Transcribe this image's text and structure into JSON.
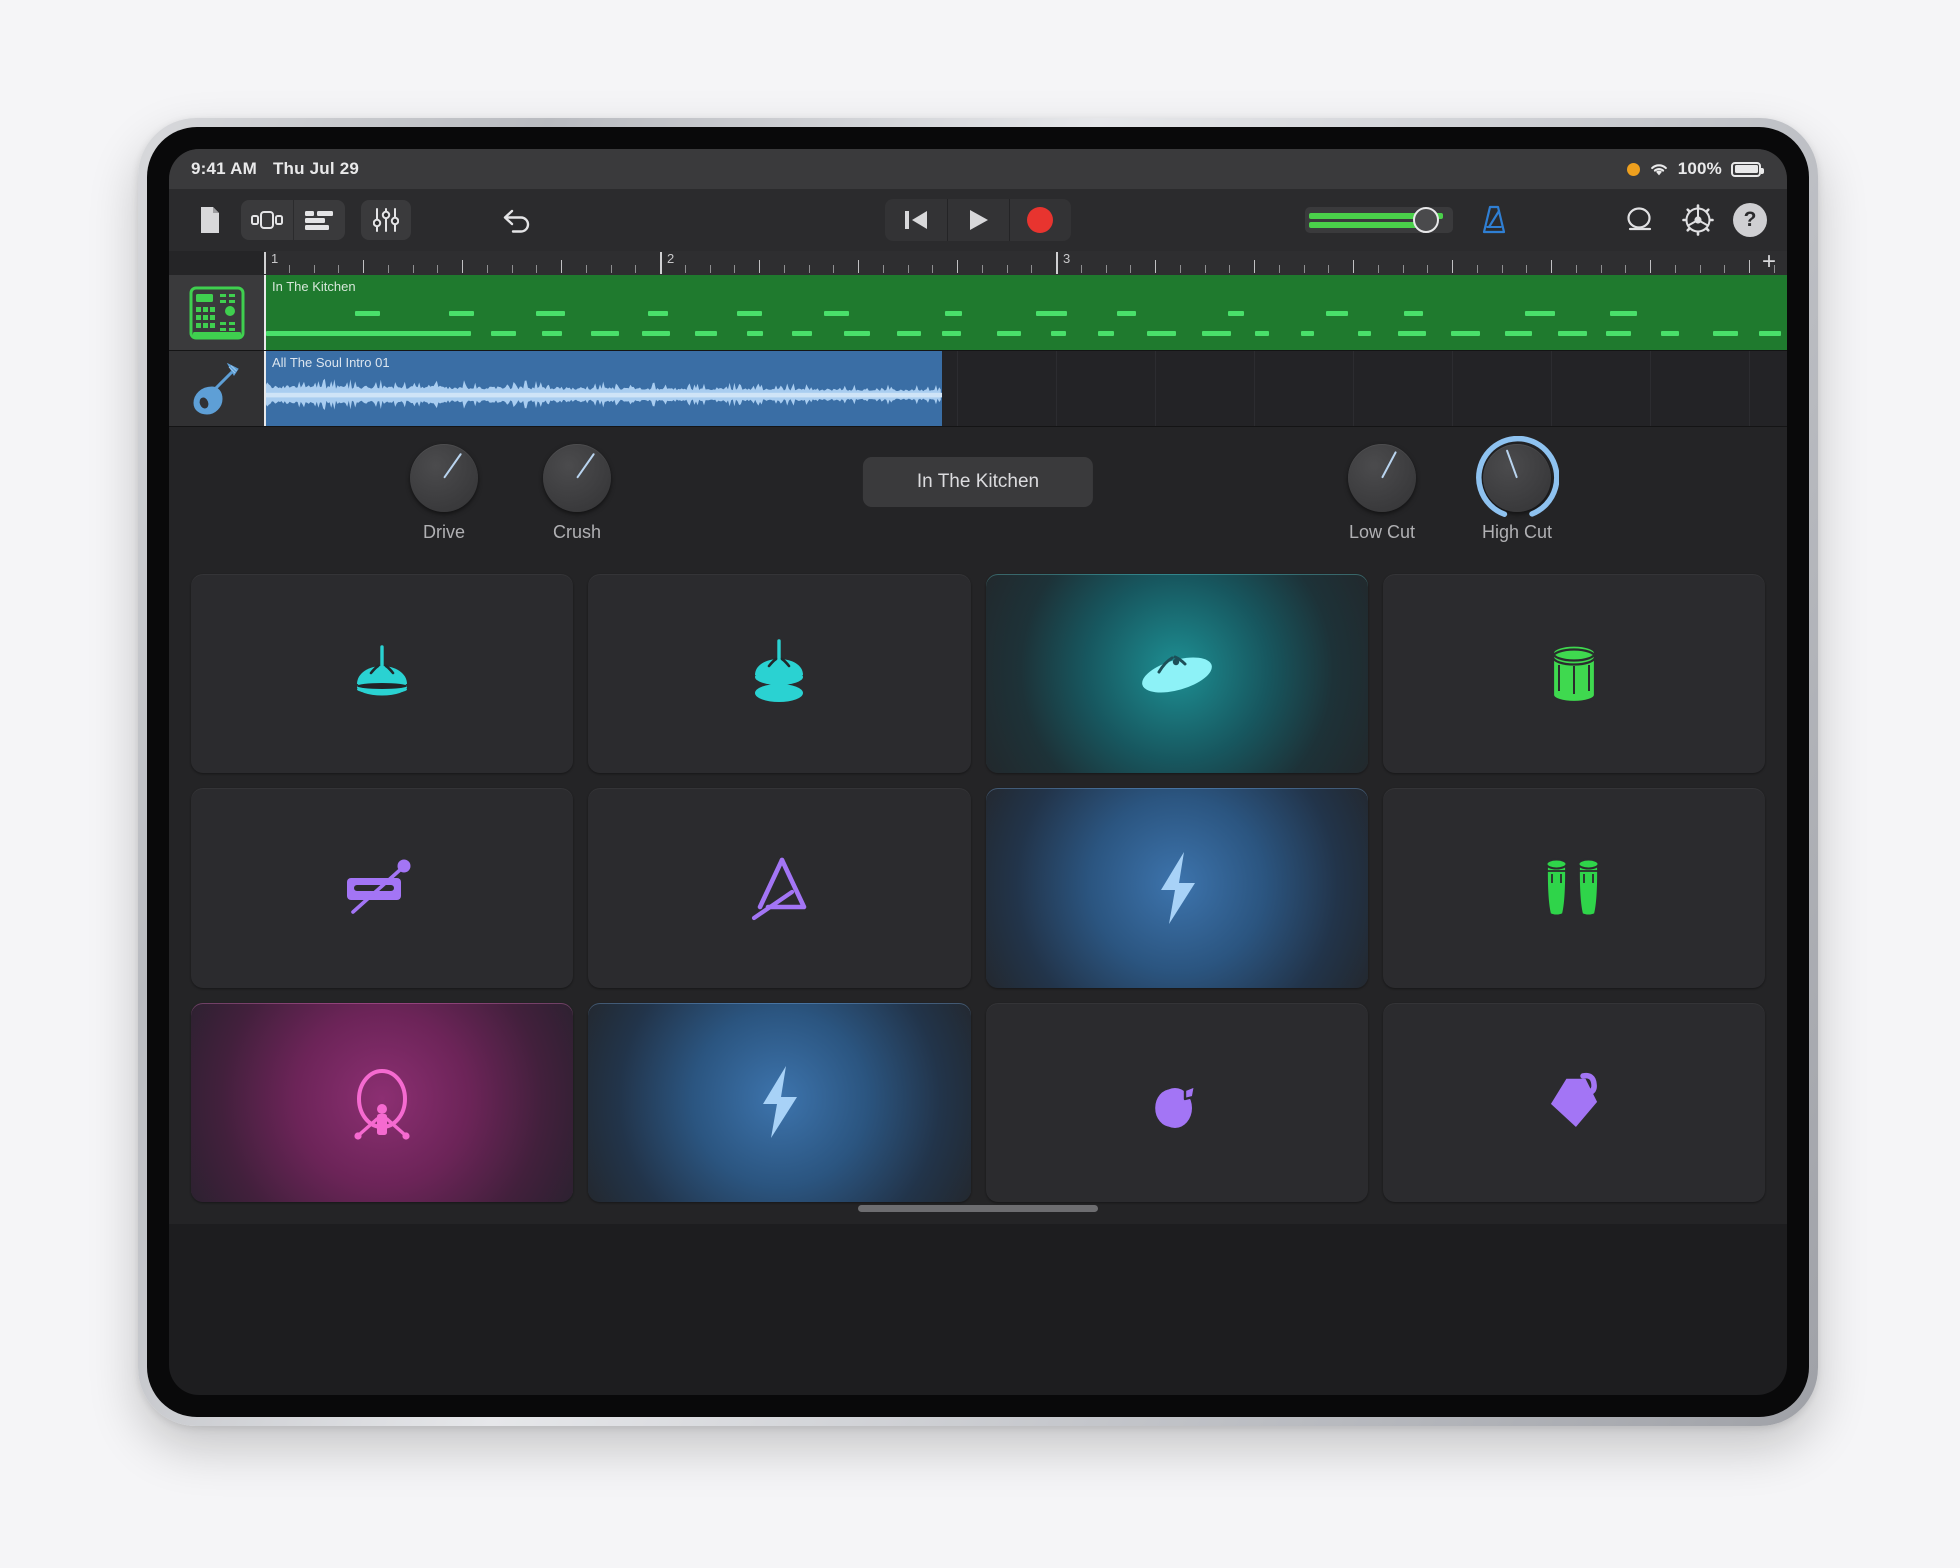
{
  "device": {
    "name": "iPad Pro",
    "home_indicator": true
  },
  "status_bar": {
    "time": "9:41 AM",
    "date": "Thu Jul 29",
    "recording_indicator": "orange-dot",
    "wifi": "wifi-icon",
    "battery_percent": "100%",
    "battery_level": 100
  },
  "toolbar": {
    "left_buttons": [
      {
        "name": "my-songs-button",
        "icon": "document-icon",
        "label": "My Songs"
      },
      {
        "name": "instrument-browser-button",
        "icon": "instrument-view-icon",
        "label": "Instrument View"
      },
      {
        "name": "tracks-view-button",
        "icon": "tracks-view-icon",
        "label": "Tracks View"
      },
      {
        "name": "mixer-button",
        "icon": "fader-sliders-icon",
        "label": "Mixer"
      },
      {
        "name": "undo-button",
        "icon": "undo-arrow-icon",
        "label": "Undo"
      }
    ],
    "transport": [
      {
        "name": "rewind-button",
        "icon": "rewind-icon",
        "label": "Rewind"
      },
      {
        "name": "play-button",
        "icon": "play-icon",
        "label": "Play"
      },
      {
        "name": "record-button",
        "icon": "record-icon",
        "label": "Record",
        "color": "#e8342f"
      }
    ],
    "master_volume": {
      "name": "master-volume-slider",
      "value_percent": 73,
      "meter_left_percent": 96,
      "meter_right_percent": 82,
      "meter_color": "#4ad04a"
    },
    "metronome": {
      "name": "metronome-button",
      "icon": "metronome-icon",
      "color": "#2f7fd4",
      "active": true
    },
    "right_buttons": [
      {
        "name": "loop-browser-button",
        "icon": "loop-icon",
        "label": "Loop Browser"
      },
      {
        "name": "settings-button",
        "icon": "gear-icon",
        "label": "Song Settings"
      },
      {
        "name": "help-button",
        "icon": "question-mark-icon",
        "label": "?"
      }
    ]
  },
  "ruler": {
    "bars": [
      "1",
      "2",
      "3"
    ],
    "add_track_label": "+"
  },
  "tracks": [
    {
      "name": "track-drum-machine",
      "icon": "drum-machine-icon",
      "icon_color": "#3fd04f",
      "selected": true,
      "region_label": "In The Kitchen",
      "region_type": "midi",
      "region_color": "#1f7a2e"
    },
    {
      "name": "track-audio-strings",
      "icon": "acoustic-strings-icon",
      "icon_color": "#5e9fd6",
      "selected": false,
      "region_label": "All The Soul Intro 01",
      "region_type": "audio",
      "region_color": "#3a6ea5"
    }
  ],
  "instrument_panel": {
    "patch_name": "In The Kitchen",
    "knobs": [
      {
        "name": "drive-knob",
        "label": "Drive",
        "angle_deg": 35,
        "ring": false,
        "ring_percent": 0
      },
      {
        "name": "crush-knob",
        "label": "Crush",
        "angle_deg": 35,
        "ring": false,
        "ring_percent": 0
      },
      {
        "name": "low-cut-knob",
        "label": "Low Cut",
        "angle_deg": 28,
        "ring": false,
        "ring_percent": 0
      },
      {
        "name": "high-cut-knob",
        "label": "High Cut",
        "angle_deg": 160,
        "ring": true,
        "ring_percent": 95,
        "ring_color": "#8ec2f0"
      }
    ]
  },
  "pads": [
    {
      "name": "pad-closed-hihat",
      "icon": "closed-hihat-icon",
      "color": "#2ad2d2",
      "active": false
    },
    {
      "name": "pad-open-hihat",
      "icon": "open-hihat-icon",
      "color": "#2ad2d2",
      "active": false
    },
    {
      "name": "pad-crash-cymbal",
      "icon": "crash-cymbal-icon",
      "color": "#8df2f7",
      "active": true,
      "glow": "cyan"
    },
    {
      "name": "pad-snare-drum",
      "icon": "snare-drum-icon",
      "color": "#3fd94f",
      "active": false
    },
    {
      "name": "pad-woodblock",
      "icon": "woodblock-icon",
      "color": "#a375f5",
      "active": false
    },
    {
      "name": "pad-triangle",
      "icon": "triangle-icon",
      "color": "#a375f5",
      "active": false
    },
    {
      "name": "pad-fx-zap-1",
      "icon": "lightning-bolt-icon",
      "color": "#a8d2f7",
      "active": true,
      "glow": "blue"
    },
    {
      "name": "pad-congas",
      "icon": "congas-icon",
      "color": "#2fd44a",
      "active": false
    },
    {
      "name": "pad-gong",
      "icon": "gong-icon",
      "color": "#f56ad0",
      "active": true,
      "glow": "pink"
    },
    {
      "name": "pad-fx-zap-2",
      "icon": "lightning-bolt-icon",
      "color": "#a8d2f7",
      "active": true,
      "glow": "blue"
    },
    {
      "name": "pad-shaker",
      "icon": "shaker-icon",
      "color": "#a375f5",
      "active": false
    },
    {
      "name": "pad-cowbell",
      "icon": "cowbell-icon",
      "color": "#a375f5",
      "active": false
    }
  ]
}
